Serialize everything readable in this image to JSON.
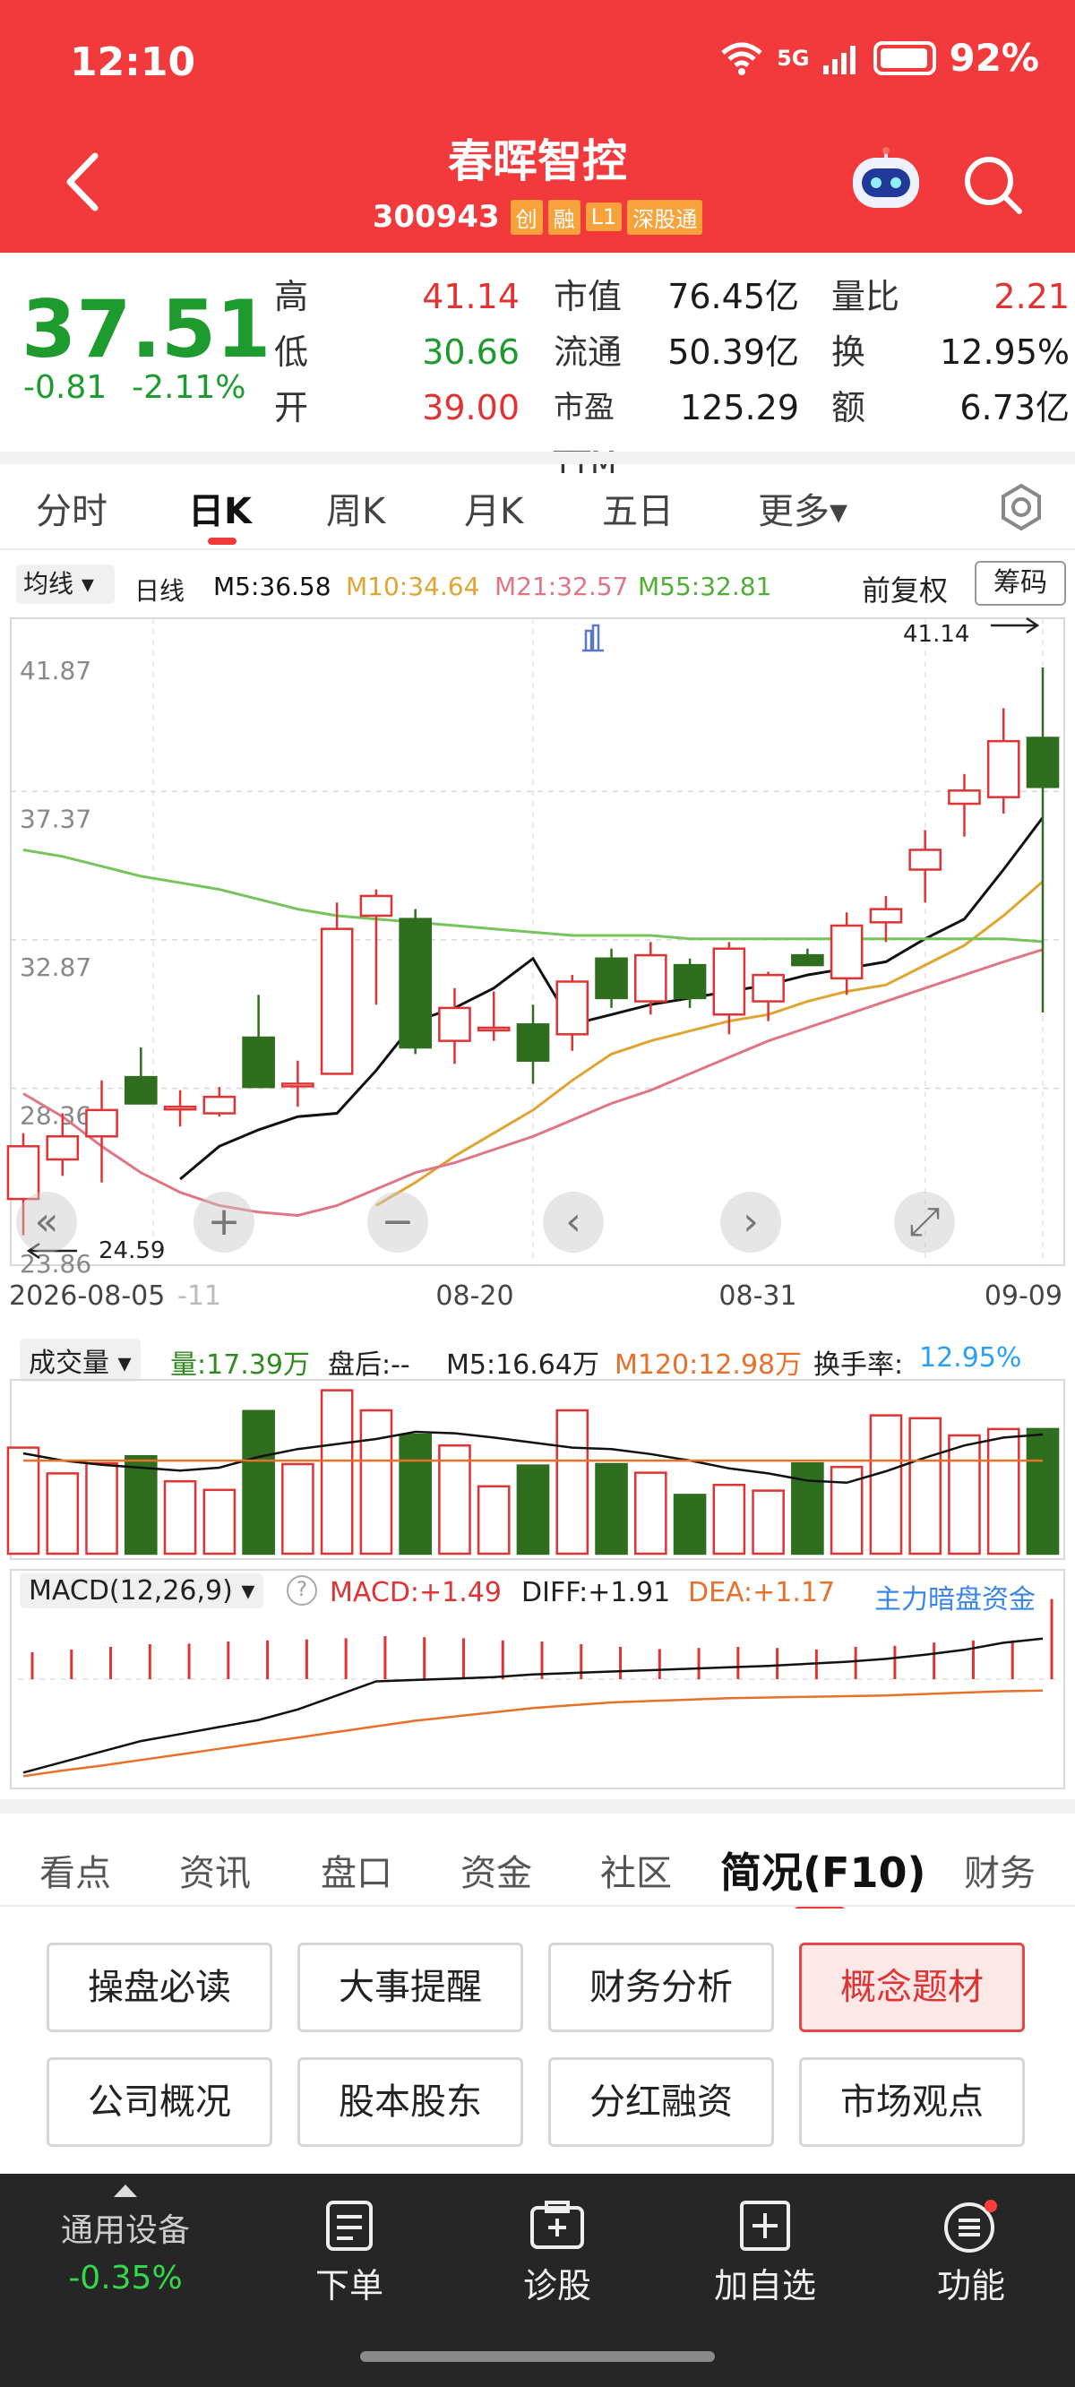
{
  "status": {
    "time": "12:10",
    "network": "5G",
    "battery": "92%"
  },
  "stock": {
    "name": "春晖智控",
    "code": "300943",
    "tags": [
      "创",
      "融",
      "L1",
      "深股通"
    ]
  },
  "quote": {
    "price": "37.51",
    "change": "-0.81",
    "change_pct": "-2.11%",
    "rows": [
      {
        "l1": "高",
        "v1": "41.14",
        "l2": "市值",
        "v2": "76.45亿",
        "l3": "量比",
        "v3": "2.21"
      },
      {
        "l1": "低",
        "v1": "30.66",
        "l2": "流通",
        "v2": "50.39亿",
        "l3": "换",
        "v3": "12.95%"
      },
      {
        "l1": "开",
        "v1": "39.00",
        "l2": "市盈TTM",
        "v2": "125.29",
        "l3": "额",
        "v3": "6.73亿"
      }
    ]
  },
  "period_tabs": [
    "分时",
    "日K",
    "周K",
    "月K",
    "五日",
    "更多▾"
  ],
  "ma": {
    "select": "均线 ▾",
    "period": "日线",
    "m5": "M5:36.58",
    "m10": "M10:34.64",
    "m21": "M21:32.57",
    "m55": "M55:32.81",
    "adjust": "前复权",
    "chip": "筹码"
  },
  "colors": {
    "up": "#e03434",
    "down": "#2f6e1f",
    "m5": "#111111",
    "m10": "#e0a530",
    "m21": "#e07585",
    "m55": "#77c45c",
    "header": "#f23a3c"
  },
  "chart_data": [
    {
      "type": "candlestick",
      "y_axis_labels": [
        "41.87",
        "37.37",
        "32.87",
        "28.36",
        "23.86"
      ],
      "ylim": [
        23.86,
        41.87
      ],
      "x_tick_labels": [
        "2026-08-05",
        "-11",
        "08-20",
        "08-31",
        "09-09"
      ],
      "max_label": "41.14",
      "min_label": "24.59",
      "candles": [
        {
          "o": 25.0,
          "h": 27.0,
          "l": 23.9,
          "c": 26.6
        },
        {
          "o": 26.2,
          "h": 27.6,
          "l": 25.7,
          "c": 26.9
        },
        {
          "o": 26.9,
          "h": 28.6,
          "l": 25.5,
          "c": 27.7
        },
        {
          "o": 28.7,
          "h": 29.6,
          "l": 28.1,
          "c": 27.9
        },
        {
          "o": 27.8,
          "h": 28.3,
          "l": 27.2,
          "c": 27.8
        },
        {
          "o": 27.6,
          "h": 28.4,
          "l": 27.5,
          "c": 28.1
        },
        {
          "o": 29.9,
          "h": 31.2,
          "l": 28.4,
          "c": 28.4
        },
        {
          "o": 28.5,
          "h": 29.2,
          "l": 27.8,
          "c": 28.5
        },
        {
          "o": 28.8,
          "h": 34.0,
          "l": 28.8,
          "c": 33.2
        },
        {
          "o": 33.6,
          "h": 34.4,
          "l": 30.9,
          "c": 34.2
        },
        {
          "o": 33.5,
          "h": 33.8,
          "l": 29.4,
          "c": 29.6
        },
        {
          "o": 29.8,
          "h": 31.4,
          "l": 29.1,
          "c": 30.8
        },
        {
          "o": 30.2,
          "h": 31.3,
          "l": 29.8,
          "c": 30.2
        },
        {
          "o": 30.3,
          "h": 30.9,
          "l": 28.5,
          "c": 29.2
        },
        {
          "o": 30.0,
          "h": 31.8,
          "l": 29.5,
          "c": 31.6
        },
        {
          "o": 32.3,
          "h": 32.6,
          "l": 30.8,
          "c": 31.1
        },
        {
          "o": 31.0,
          "h": 32.8,
          "l": 30.6,
          "c": 32.4
        },
        {
          "o": 32.1,
          "h": 32.3,
          "l": 30.8,
          "c": 31.1
        },
        {
          "o": 30.6,
          "h": 32.8,
          "l": 30.0,
          "c": 32.6
        },
        {
          "o": 31.0,
          "h": 31.9,
          "l": 30.4,
          "c": 31.8
        },
        {
          "o": 32.4,
          "h": 32.6,
          "l": 32.1,
          "c": 32.1
        },
        {
          "o": 31.7,
          "h": 33.7,
          "l": 31.2,
          "c": 33.3
        },
        {
          "o": 33.4,
          "h": 34.2,
          "l": 32.8,
          "c": 33.8
        },
        {
          "o": 35.0,
          "h": 36.2,
          "l": 34.0,
          "c": 35.6
        },
        {
          "o": 37.0,
          "h": 37.9,
          "l": 36.0,
          "c": 37.4
        },
        {
          "o": 37.2,
          "h": 39.9,
          "l": 36.7,
          "c": 38.9
        },
        {
          "o": 39.0,
          "h": 41.14,
          "l": 30.66,
          "c": 37.51
        }
      ],
      "series": [
        {
          "name": "M5",
          "values": [
            null,
            null,
            null,
            null,
            25.6,
            26.6,
            27.1,
            27.5,
            27.6,
            28.9,
            30.4,
            30.8,
            31.4,
            32.3,
            30.3,
            30.6,
            30.9,
            31.1,
            31.3,
            31.5,
            31.8,
            32.0,
            32.2,
            32.9,
            33.5,
            35.0,
            36.58
          ]
        },
        {
          "name": "M10",
          "values": [
            null,
            null,
            null,
            null,
            null,
            null,
            null,
            null,
            null,
            24.8,
            25.5,
            26.3,
            27.0,
            27.7,
            28.6,
            29.4,
            29.8,
            30.1,
            30.4,
            30.6,
            31.0,
            31.3,
            31.5,
            32.1,
            32.7,
            33.6,
            34.64
          ]
        },
        {
          "name": "M21",
          "values": [
            28.2,
            27.5,
            26.6,
            25.8,
            25.2,
            24.8,
            24.6,
            24.5,
            24.8,
            25.3,
            25.8,
            26.1,
            26.5,
            26.9,
            27.4,
            27.9,
            28.3,
            28.8,
            29.3,
            29.8,
            30.2,
            30.6,
            31.0,
            31.4,
            31.8,
            32.2,
            32.57
          ]
        },
        {
          "name": "M55",
          "values": [
            35.6,
            35.4,
            35.1,
            34.8,
            34.6,
            34.4,
            34.1,
            33.8,
            33.6,
            33.5,
            33.4,
            33.3,
            33.2,
            33.1,
            33.0,
            33.0,
            33.0,
            32.9,
            32.9,
            32.9,
            32.9,
            32.9,
            32.9,
            32.9,
            32.9,
            32.9,
            32.81
          ]
        }
      ]
    },
    {
      "type": "bar",
      "name": "成交量",
      "values": [
        14.8,
        11.2,
        12.6,
        13.6,
        10.1,
        8.9,
        19.9,
        12.5,
        22.8,
        20.0,
        16.6,
        15.1,
        9.4,
        12.3,
        20.0,
        12.5,
        11.3,
        8.2,
        9.6,
        8.8,
        12.6,
        12.1,
        19.3,
        18.9,
        16.5,
        17.39,
        17.39
      ],
      "ma5": [
        14.0,
        13.0,
        12.4,
        12.0,
        11.6,
        12.0,
        13.5,
        14.6,
        15.3,
        16.0,
        17.0,
        16.8,
        16.2,
        15.5,
        14.8,
        14.6,
        13.9,
        13.0,
        11.9,
        11.2,
        10.2,
        9.9,
        11.5,
        13.4,
        15.1,
        16.2,
        16.64
      ],
      "ma120": 12.98
    },
    {
      "type": "macd",
      "macd_values": [
        0.5,
        0.55,
        0.6,
        0.65,
        0.66,
        0.7,
        0.72,
        0.74,
        0.76,
        0.8,
        0.78,
        0.76,
        0.72,
        0.7,
        0.65,
        0.6,
        0.56,
        0.58,
        0.6,
        0.58,
        0.55,
        0.6,
        0.62,
        0.68,
        0.72,
        0.72,
        1.49
      ],
      "diff": [
        0.0,
        0.15,
        0.3,
        0.45,
        0.55,
        0.65,
        0.75,
        0.9,
        1.1,
        1.3,
        1.32,
        1.34,
        1.36,
        1.4,
        1.42,
        1.44,
        1.46,
        1.48,
        1.5,
        1.52,
        1.55,
        1.58,
        1.62,
        1.68,
        1.75,
        1.85,
        1.91
      ],
      "dea": [
        -0.05,
        0.03,
        0.1,
        0.18,
        0.26,
        0.34,
        0.42,
        0.5,
        0.58,
        0.66,
        0.74,
        0.8,
        0.86,
        0.92,
        0.96,
        1.0,
        1.02,
        1.04,
        1.06,
        1.07,
        1.08,
        1.09,
        1.1,
        1.12,
        1.14,
        1.16,
        1.17
      ]
    }
  ],
  "volume": {
    "select": "成交量 ▾",
    "vol": "量:17.39万",
    "after": "盘后:--",
    "m5": "M5:16.64万",
    "m120": "M120:12.98万",
    "turnover_label": "换手率:",
    "turnover": "12.95%"
  },
  "macd": {
    "select": "MACD(12,26,9) ▾",
    "help": "?",
    "macd": "MACD:+1.49",
    "diff": "DIFF:+1.91",
    "dea": "DEA:+1.17",
    "link": "主力暗盘资金"
  },
  "bottom_tabs": [
    "看点",
    "资讯",
    "盘口",
    "资金",
    "社区",
    "简况(F10)",
    "财务"
  ],
  "buttons": [
    "操盘必读",
    "大事提醒",
    "财务分析",
    "概念题材",
    "公司概况",
    "股本股东",
    "分红融资",
    "市场观点"
  ],
  "footer": {
    "index_name": "通用设备",
    "index_change": "-0.35%",
    "items": [
      "下单",
      "诊股",
      "加自选",
      "功能"
    ]
  }
}
